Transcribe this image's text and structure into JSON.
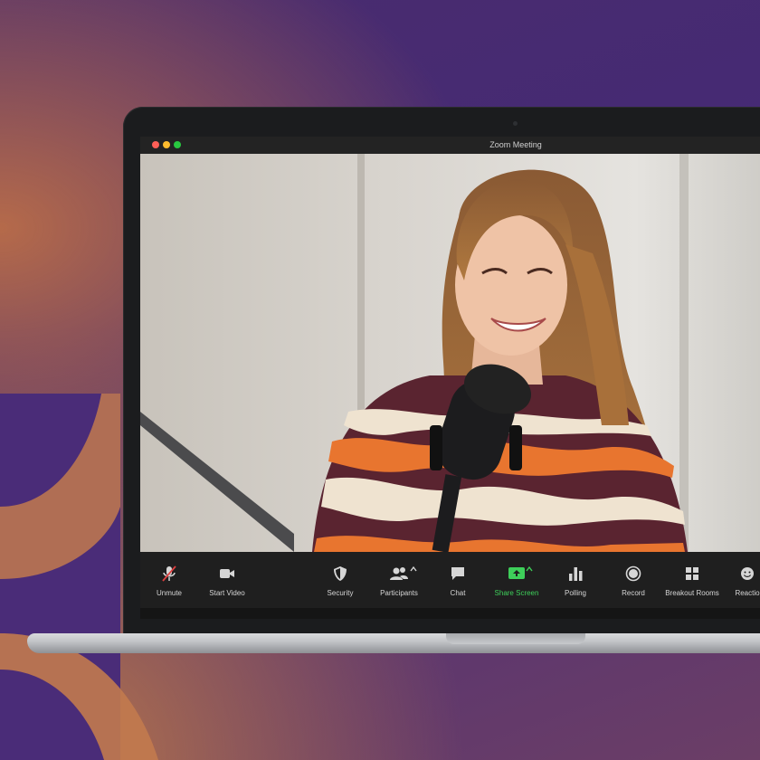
{
  "window": {
    "title": "Zoom Meeting"
  },
  "toolbar": {
    "items": [
      {
        "label": "Unmute",
        "icon": "muted-microphone-icon"
      },
      {
        "label": "Start Video",
        "icon": "video-camera-icon"
      },
      {
        "label": "Security",
        "icon": "shield-icon"
      },
      {
        "label": "Participants",
        "icon": "participants-icon"
      },
      {
        "label": "Chat",
        "icon": "chat-bubble-icon"
      },
      {
        "label": "Share Screen",
        "icon": "share-screen-icon"
      },
      {
        "label": "Polling",
        "icon": "bar-chart-icon"
      },
      {
        "label": "Record",
        "icon": "record-icon"
      },
      {
        "label": "Breakout Rooms",
        "icon": "grid-icon"
      },
      {
        "label": "Reactio",
        "icon": "emoji-icon"
      }
    ]
  },
  "colors": {
    "share_green": "#3ecf5a",
    "toolbar_bg": "#1f1f1f",
    "background_purple": "#452a74"
  }
}
